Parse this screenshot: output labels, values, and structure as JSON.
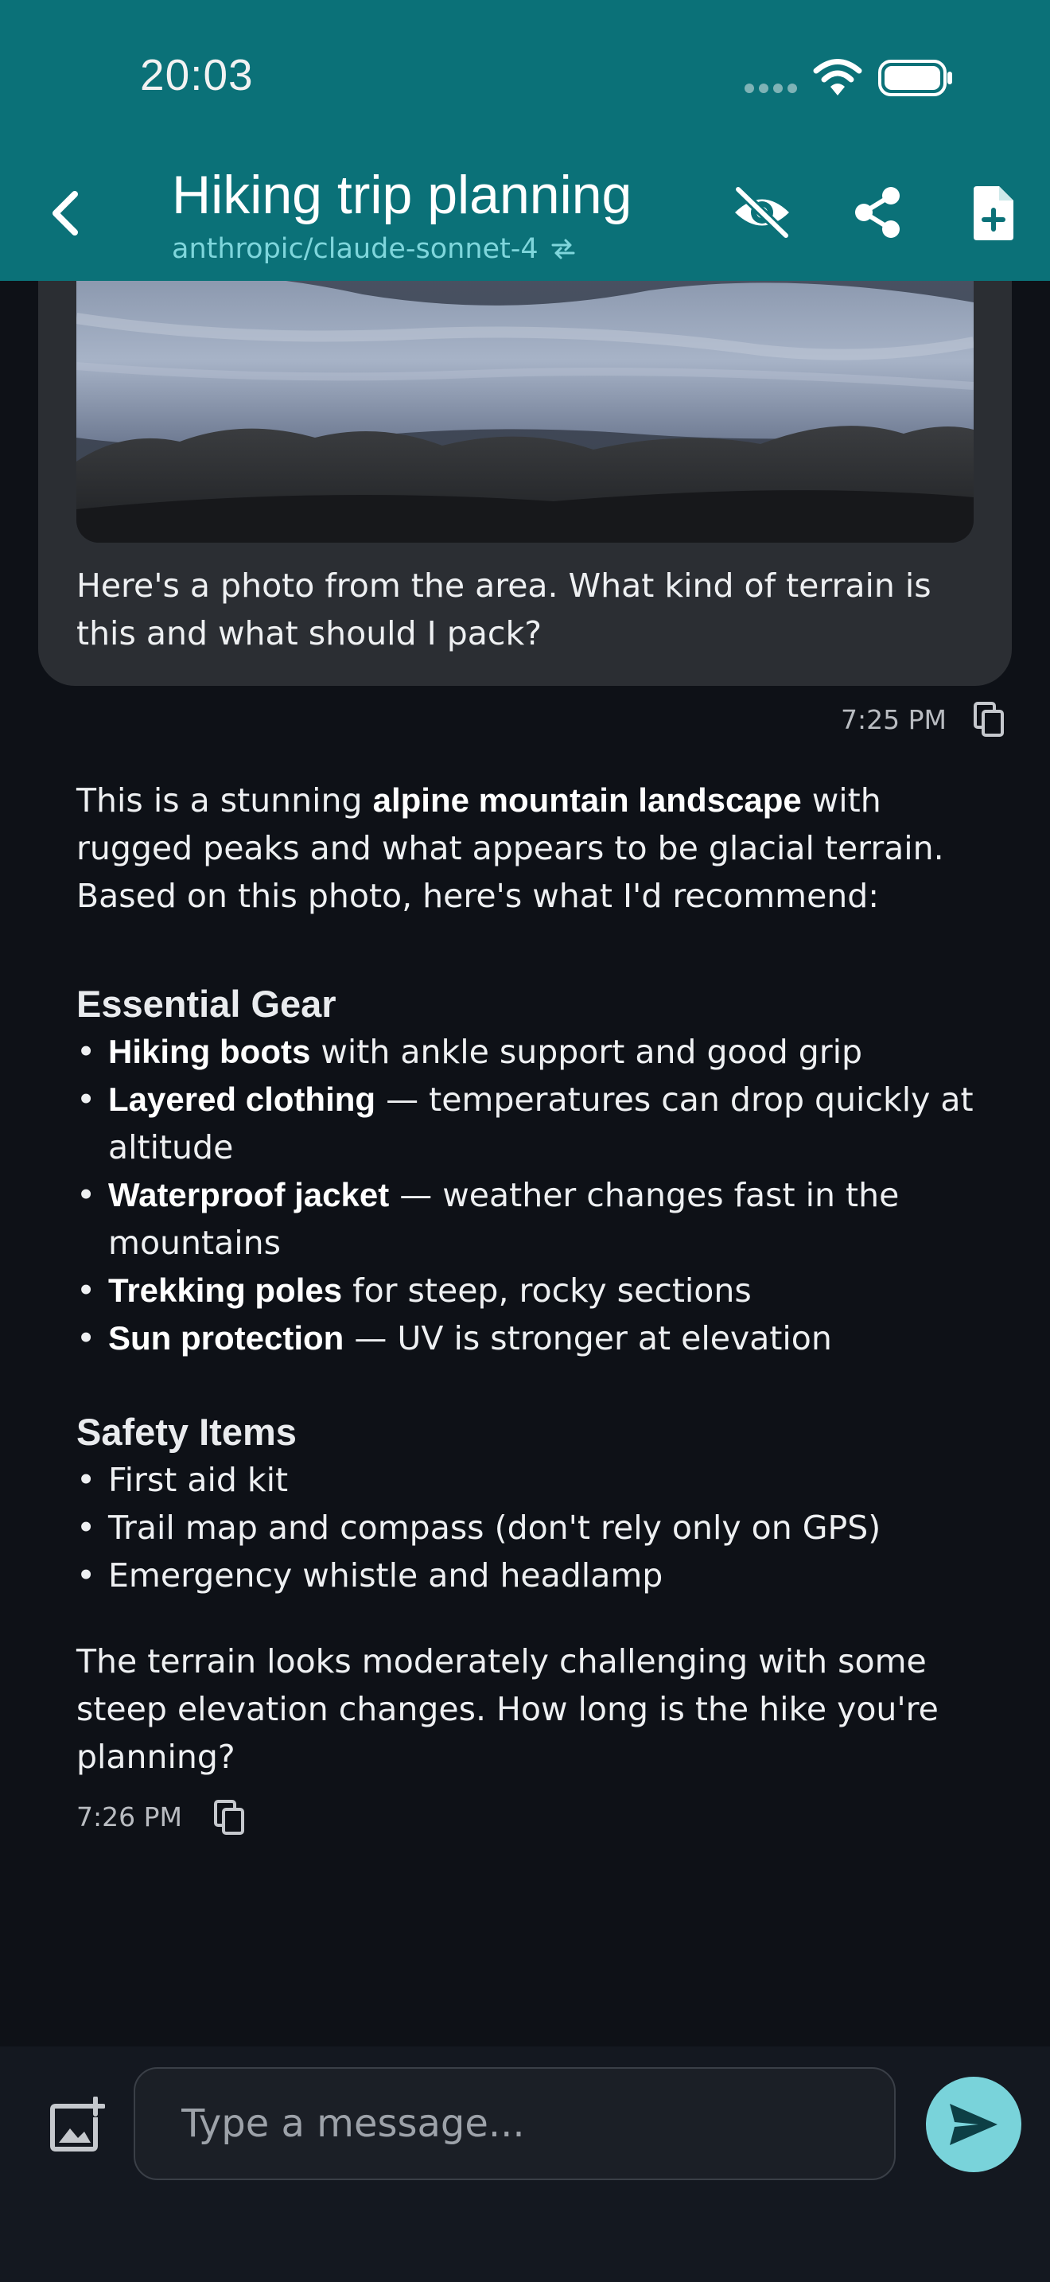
{
  "status_bar": {
    "time": "20:03"
  },
  "header": {
    "title": "Hiking trip planning",
    "model": "anthropic/claude-sonnet-4",
    "icons": [
      "back-arrow-icon",
      "swap-icon",
      "eye-off-icon",
      "share-icon",
      "new-document-icon"
    ]
  },
  "user_message": {
    "text": "Here's a photo from the area. What kind of terrain is this and what should I pack?",
    "time": "7:25 PM"
  },
  "assistant_message": {
    "intro_pre": "This is a stunning ",
    "intro_bold": "alpine mountain landscape",
    "intro_post": " with rugged peaks and what appears to be glacial terrain. Based on this photo, here's what I'd recommend:",
    "gear_heading": "Essential Gear",
    "gear_items": [
      {
        "bold": "Hiking boots",
        "rest": " with ankle support and good grip"
      },
      {
        "bold": "Layered clothing",
        "rest": " — temperatures can drop quickly at altitude"
      },
      {
        "bold": "Waterproof jacket",
        "rest": " — weather changes fast in the mountains"
      },
      {
        "bold": "Trekking poles",
        "rest": " for steep, rocky sections"
      },
      {
        "bold": "Sun protection",
        "rest": " — UV is stronger at elevation"
      }
    ],
    "safety_heading": "Safety Items",
    "safety_items": [
      "First aid kit",
      "Trail map and compass (don't rely only on GPS)",
      "Emergency whistle and headlamp"
    ],
    "closing": "The terrain looks moderately challenging with some steep elevation changes. How long is the hike you're planning?",
    "time": "7:26 PM"
  },
  "composer": {
    "placeholder": "Type a message...",
    "value": ""
  },
  "colors": {
    "header_bg": "#0b7178",
    "background": "#0e1117",
    "bubble_bg": "#2b2e33",
    "accent": "#79d3da"
  }
}
